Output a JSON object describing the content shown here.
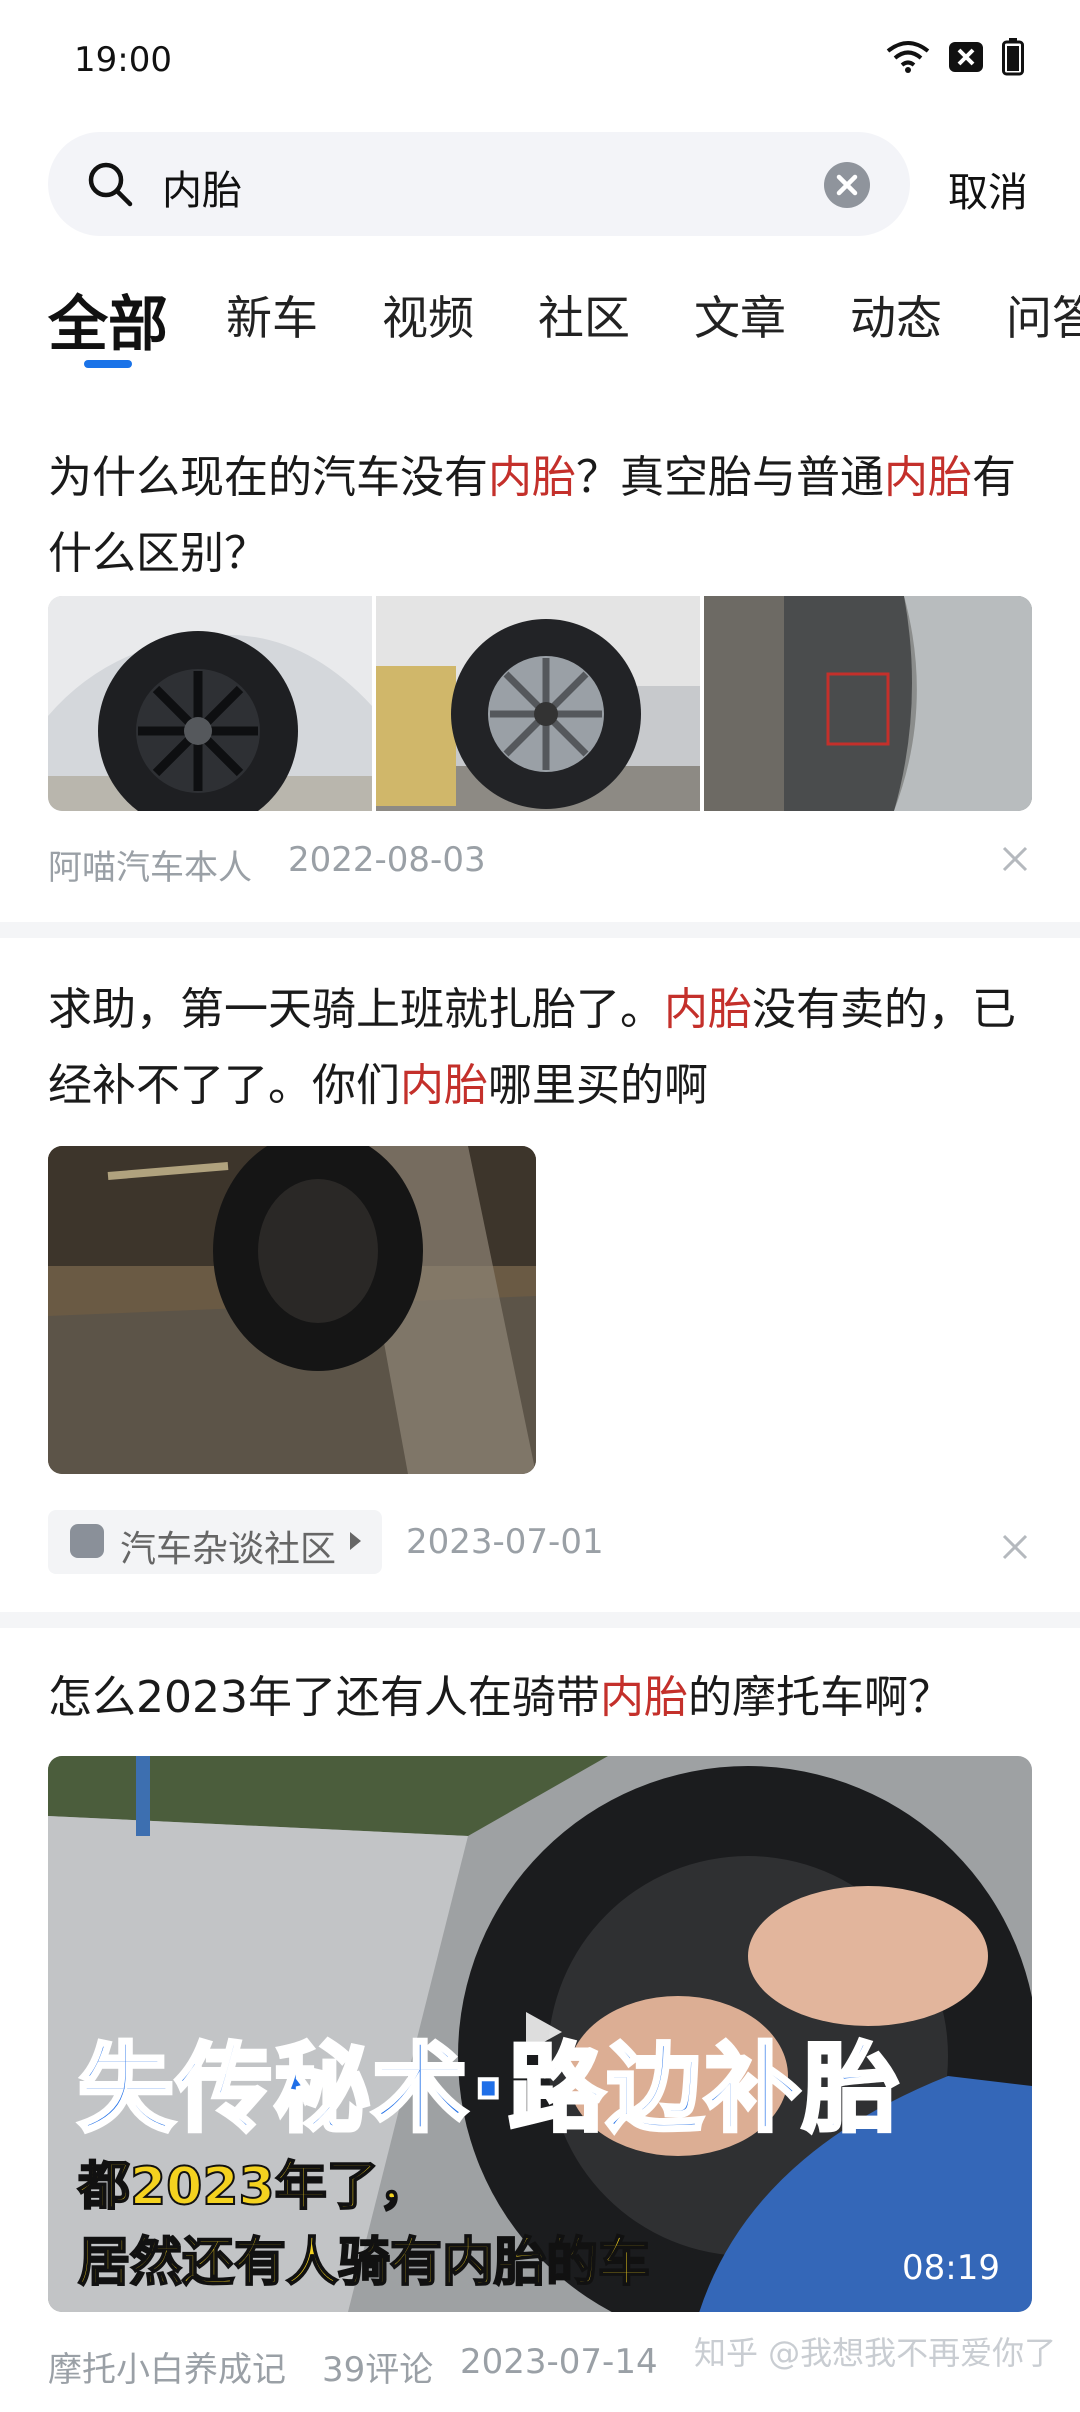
{
  "status": {
    "time": "19:00"
  },
  "search": {
    "query": "内胎",
    "cancel": "取消"
  },
  "tabs": [
    "全部",
    "新车",
    "视频",
    "社区",
    "文章",
    "动态",
    "问答"
  ],
  "results": [
    {
      "title_parts": [
        "为什么现在的汽车没有",
        "内胎",
        "？真空胎与普通",
        "内胎",
        "有什么区别？"
      ],
      "author": "阿喵汽车本人",
      "date": "2022-08-03"
    },
    {
      "title_parts": [
        "求助，第一天骑上班就扎胎了。",
        "内胎",
        "没有卖的，已经补不了了。你们",
        "内胎",
        "哪里买的啊"
      ],
      "community": "汽车杂谈社区",
      "date": "2023-07-01"
    },
    {
      "title_parts": [
        "怎么2023年了还有人在骑带",
        "内胎",
        "的摩托车啊？"
      ],
      "video_title": "失传秘术·路边补胎",
      "video_sub1": "都2023年了，",
      "video_sub2": "居然还有人骑有内胎的车",
      "duration": "08:19",
      "author": "摩托小白养成记",
      "comments": "39评论",
      "date": "2023-07-14"
    }
  ],
  "watermark": "知乎 @我想我不再爱你了",
  "colors": {
    "highlight": "#c4302b",
    "accent": "#1a73e8"
  }
}
